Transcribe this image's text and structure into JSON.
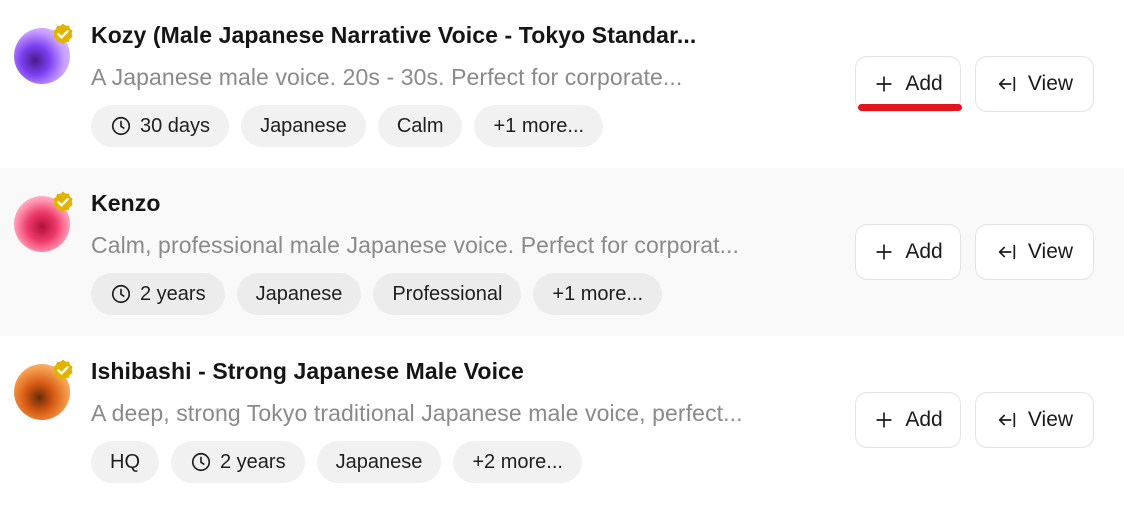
{
  "colors": {
    "verified_badge": "#e0b400",
    "annotation_underline": "#e4141b"
  },
  "voices": [
    {
      "title": "Kozy (Male Japanese Narrative Voice - Tokyo Standar...",
      "description": "A Japanese male voice. 20s - 30s. Perfect for corporate...",
      "tags": [
        {
          "icon": "clock-icon",
          "label": "30 days"
        },
        {
          "label": "Japanese"
        },
        {
          "label": "Calm"
        },
        {
          "label": "+1 more..."
        }
      ],
      "add_label": "Add",
      "view_label": "View"
    },
    {
      "title": "Kenzo",
      "description": "Calm, professional male Japanese voice. Perfect for corporat...",
      "tags": [
        {
          "icon": "clock-icon",
          "label": "2 years"
        },
        {
          "label": "Japanese"
        },
        {
          "label": "Professional"
        },
        {
          "label": "+1 more..."
        }
      ],
      "add_label": "Add",
      "view_label": "View"
    },
    {
      "title": "Ishibashi - Strong Japanese Male Voice",
      "description": "A deep, strong Tokyo traditional Japanese male voice, perfect...",
      "tags": [
        {
          "label": "HQ"
        },
        {
          "icon": "clock-icon",
          "label": "2 years"
        },
        {
          "label": "Japanese"
        },
        {
          "label": "+2 more..."
        }
      ],
      "add_label": "Add",
      "view_label": "View"
    }
  ]
}
